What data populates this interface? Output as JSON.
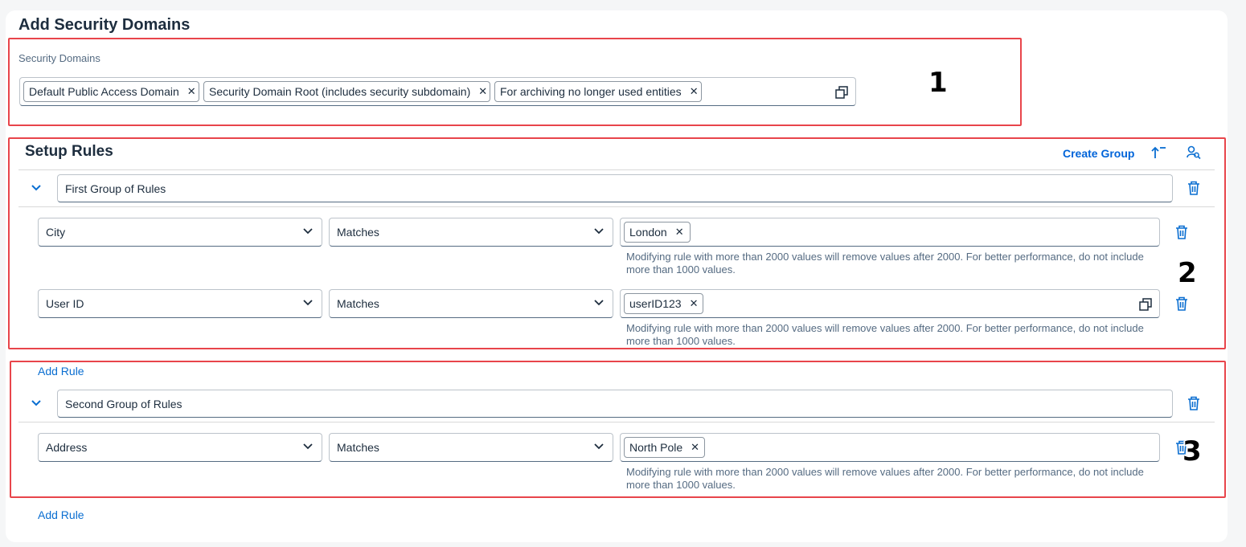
{
  "page": {
    "title": "Add Security Domains"
  },
  "security_domains": {
    "label": "Security Domains",
    "tokens": [
      "Default Public Access Domain",
      "Security Domain Root (includes security subdomain)",
      "For archiving no longer used entities"
    ]
  },
  "setup_rules": {
    "title": "Setup Rules",
    "create_group_label": "Create Group",
    "groups": [
      {
        "name": "First Group of Rules",
        "add_rule_label": "Add Rule",
        "rules": [
          {
            "attribute": "City",
            "operator": "Matches",
            "values": [
              "London"
            ],
            "hint": "Modifying rule with more than 2000 values will remove values after 2000. For better performance, do not include more than 1000 values."
          },
          {
            "attribute": "User ID",
            "operator": "Matches",
            "values": [
              "userID123"
            ],
            "hint": "Modifying rule with more than 2000 values will remove values after 2000. For better performance, do not include more than 1000 values."
          }
        ]
      },
      {
        "name": "Second Group of Rules",
        "add_rule_label": "Add Rule",
        "rules": [
          {
            "attribute": "Address",
            "operator": "Matches",
            "values": [
              "North Pole"
            ],
            "hint": "Modifying rule with more than 2000 values will remove values after 2000. For better performance, do not include more than 1000 values."
          }
        ]
      }
    ]
  },
  "callouts": [
    "1",
    "2",
    "3"
  ],
  "colors": {
    "accent": "#0a6ed1",
    "annotation_border": "#e8454b",
    "text": "#1d2d3e",
    "muted": "#556b82"
  },
  "icons": {
    "token_remove": "close-icon",
    "value_help": "value-help-icon",
    "sort": "sort-ascending-icon",
    "user_search": "user-search-icon",
    "delete": "trash-icon",
    "collapse": "chevron-down-icon",
    "dropdown": "chevron-down-icon"
  }
}
